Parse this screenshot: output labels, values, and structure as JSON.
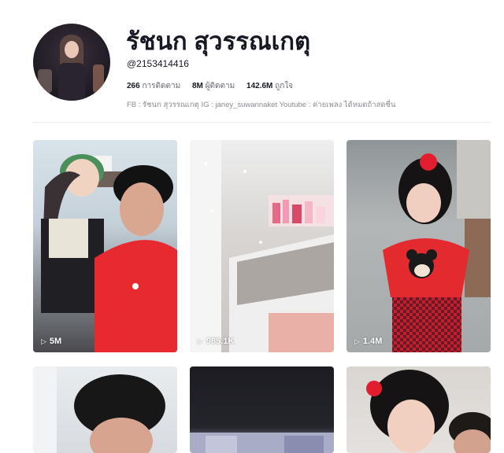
{
  "profile": {
    "name": "รัชนก สุวรรณเกตุ",
    "handle": "@2153414416",
    "stats": [
      {
        "value": "266",
        "label": "การติดตาม"
      },
      {
        "value": "8M",
        "label": "ผู้ติดตาม"
      },
      {
        "value": "142.6M",
        "label": "ถูกใจ"
      }
    ],
    "bio": "FB : รัชนก สุวรรณเกตุ IG : janey_suwannaket Youtube : ค่ายเพลง ได้หมดถ้าสดชื่น"
  },
  "videos": [
    {
      "views": "5M"
    },
    {
      "views": "985.1K"
    },
    {
      "views": "1.4M"
    },
    {
      "views": ""
    },
    {
      "views": ""
    },
    {
      "views": ""
    }
  ],
  "colors": {
    "text": "#161823",
    "muted": "#8a8b91",
    "accent_red": "#e8262b"
  }
}
